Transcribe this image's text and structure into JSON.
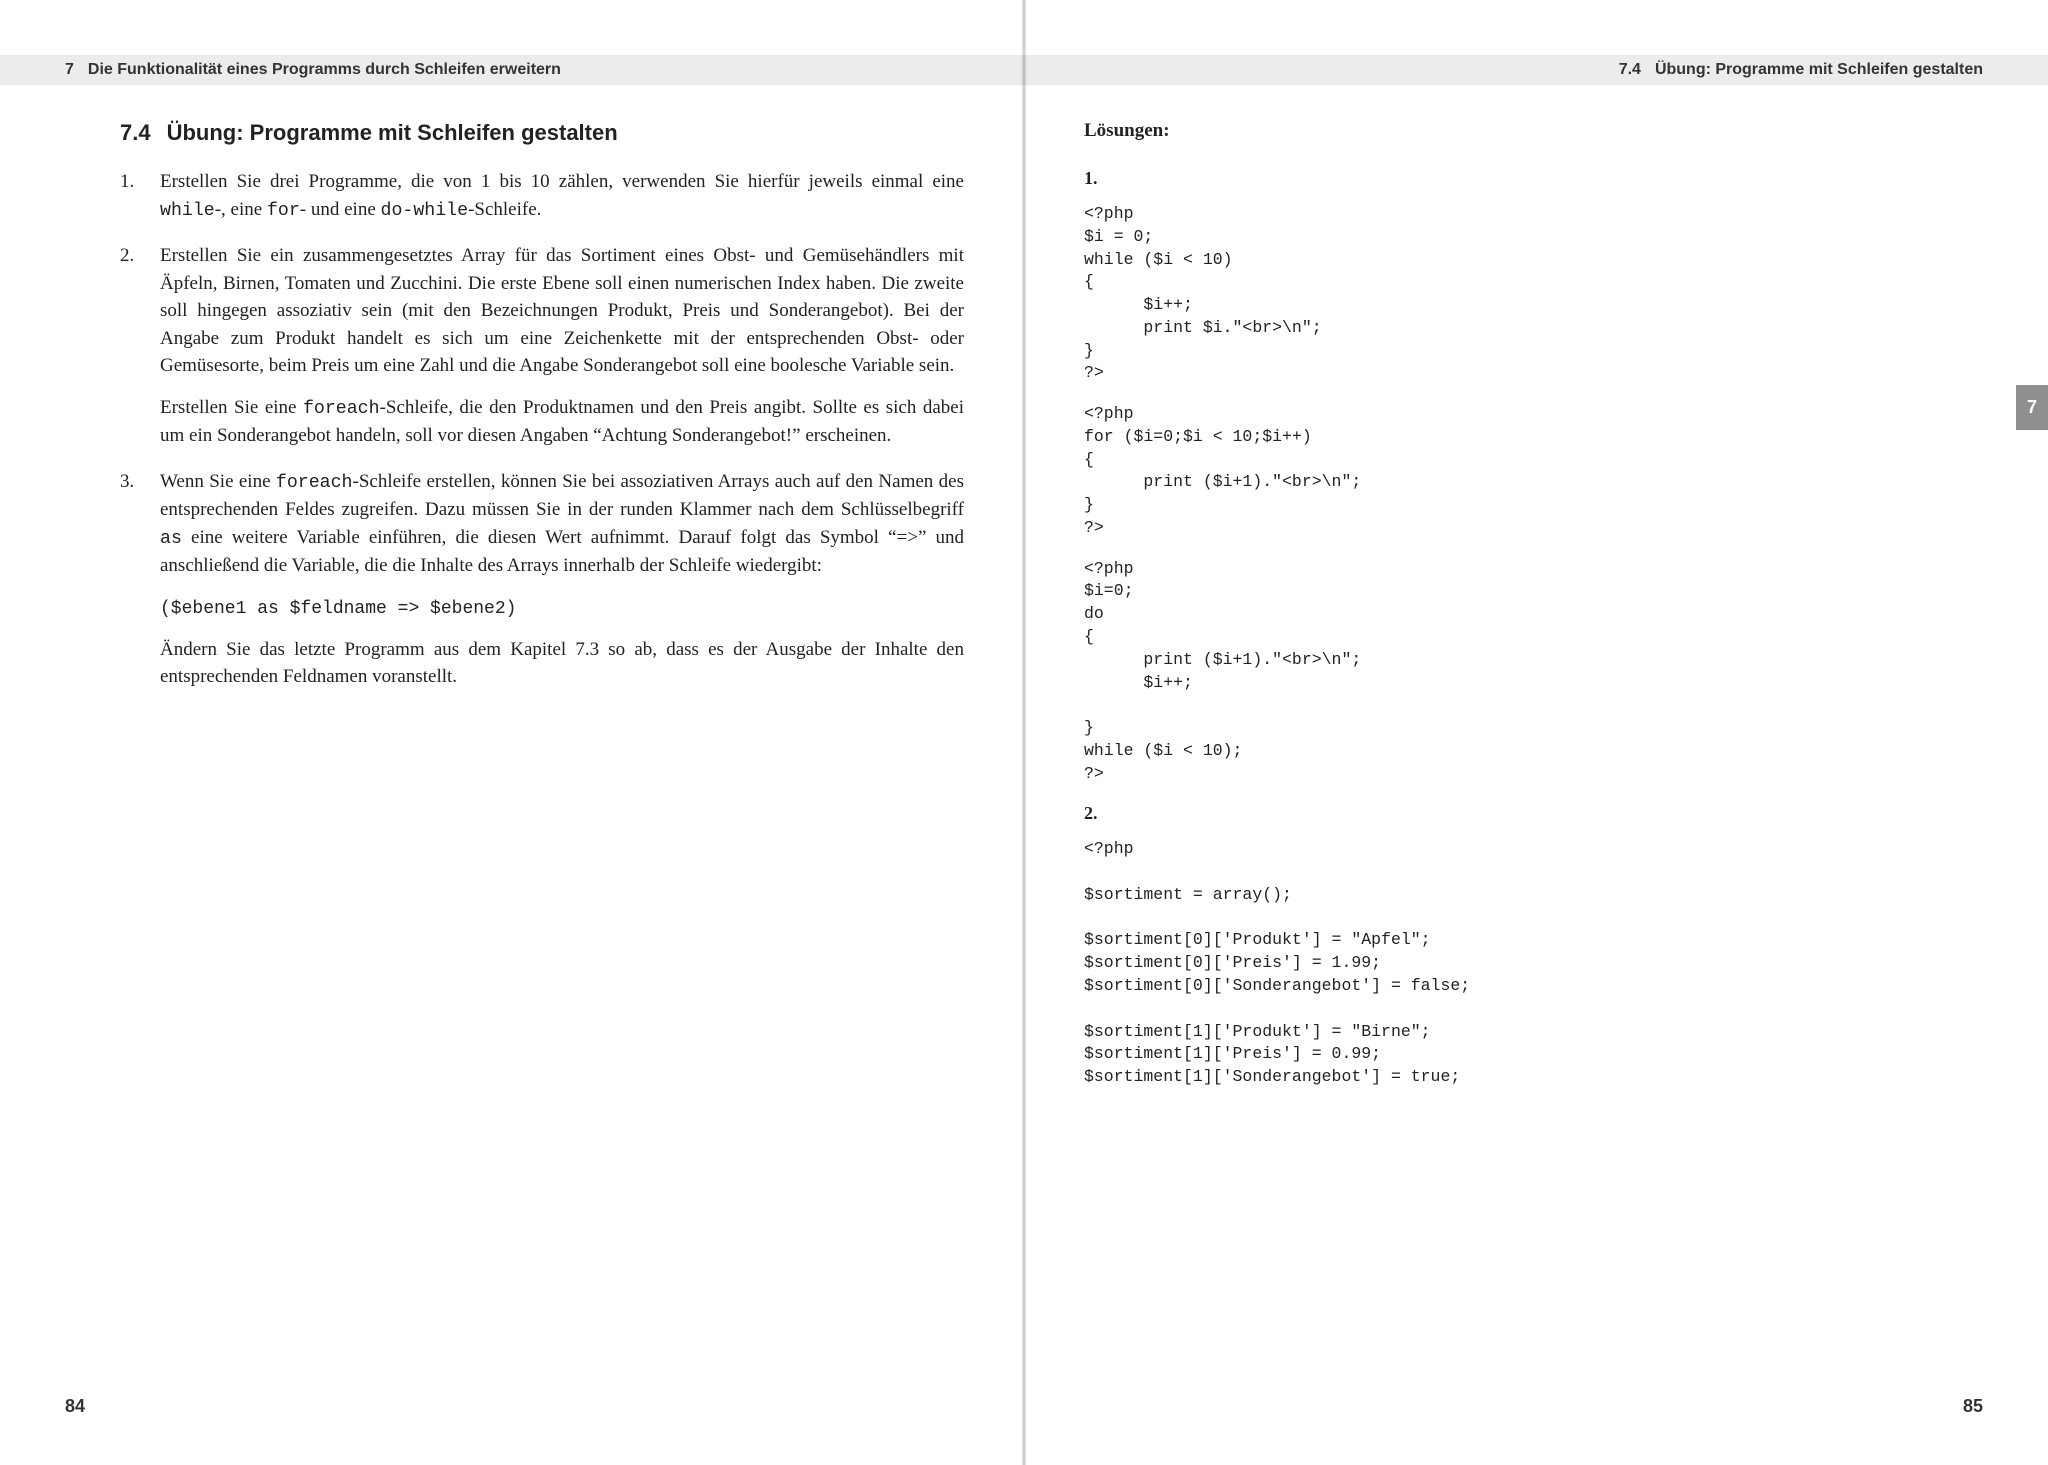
{
  "left": {
    "runhead_num": "7",
    "runhead_text": "Die Funktionalität eines Programms durch Schleifen erweitern",
    "section_num": "7.4",
    "section_title": "Übung: Programme mit Schleifen gestalten",
    "items": [
      {
        "marker": "1.",
        "paras": [
          "Erstellen Sie drei Programme, die von 1 bis 10 zählen, verwenden Sie hierfür jeweils einmal eine <span class=\"mono\">while</span>-, eine <span class=\"mono\">for</span>- und eine <span class=\"mono\">do-while</span>-Schleife."
        ]
      },
      {
        "marker": "2.",
        "paras": [
          "Erstellen Sie ein zusammengesetztes Array für das Sortiment eines Obst- und Gemüsehändlers mit Äpfeln, Birnen, Tomaten und Zucchini. Die erste Ebene soll einen numerischen Index haben. Die zweite soll hingegen assoziativ sein (mit den Bezeichnungen Produkt, Preis und Sonderangebot). Bei der Angabe zum Produkt handelt es sich um eine Zeichenkette mit der entsprechenden Obst- oder Gemüsesorte, beim Preis um eine Zahl und die Angabe Sonderangebot soll eine boolesche Variable sein.",
          "Erstellen Sie eine <span class=\"mono\">foreach</span>-Schleife, die den Produktnamen und den Preis angibt. Sollte es sich dabei um ein Sonderangebot handeln, soll vor diesen Angaben “Achtung Sonderangebot!” erscheinen."
        ]
      },
      {
        "marker": "3.",
        "paras": [
          "Wenn Sie eine <span class=\"mono\">foreach</span>-Schleife erstellen, können Sie bei assoziativen Arrays auch auf den Namen des entsprechenden Feldes zugreifen. Dazu müssen Sie in der runden Klammer nach dem Schlüsselbegriff <span class=\"mono\">as</span> eine weitere Variable einführen, die diesen Wert aufnimmt. Darauf folgt das Symbol “=>” und anschließend die Variable, die die Inhalte des Arrays innerhalb der Schleife wiedergibt:",
          "<span class=\"codeline\">($ebene1 as $feldname =&gt; $ebene2)</span>",
          "Ändern Sie das letzte Programm aus dem Kapitel 7.3 so ab, dass es der Ausgabe der Inhalte den entsprechenden Feldnamen voranstellt."
        ]
      }
    ],
    "pagenum": "84"
  },
  "right": {
    "runhead_num": "7.4",
    "runhead_text": "Übung: Programme mit Schleifen gestalten",
    "tab": "7",
    "sol_heading": "Lösungen:",
    "blocks": [
      {
        "type": "num",
        "text": "1."
      },
      {
        "type": "code",
        "text": "<?php\n$i = 0;\nwhile ($i < 10)\n{\n      $i++;\n      print $i.\"<br>\\n\";\n}\n?>"
      },
      {
        "type": "code",
        "text": "<?php\nfor ($i=0;$i < 10;$i++)\n{\n      print ($i+1).\"<br>\\n\";\n}\n?>"
      },
      {
        "type": "code",
        "text": "<?php\n$i=0;\ndo\n{\n      print ($i+1).\"<br>\\n\";\n      $i++;\n\n}\nwhile ($i < 10);\n?>"
      },
      {
        "type": "num",
        "text": "2."
      },
      {
        "type": "code",
        "text": "<?php\n\n$sortiment = array();\n\n$sortiment[0]['Produkt'] = \"Apfel\";\n$sortiment[0]['Preis'] = 1.99;\n$sortiment[0]['Sonderangebot'] = false;\n\n$sortiment[1]['Produkt'] = \"Birne\";\n$sortiment[1]['Preis'] = 0.99;\n$sortiment[1]['Sonderangebot'] = true;"
      }
    ],
    "pagenum": "85"
  }
}
